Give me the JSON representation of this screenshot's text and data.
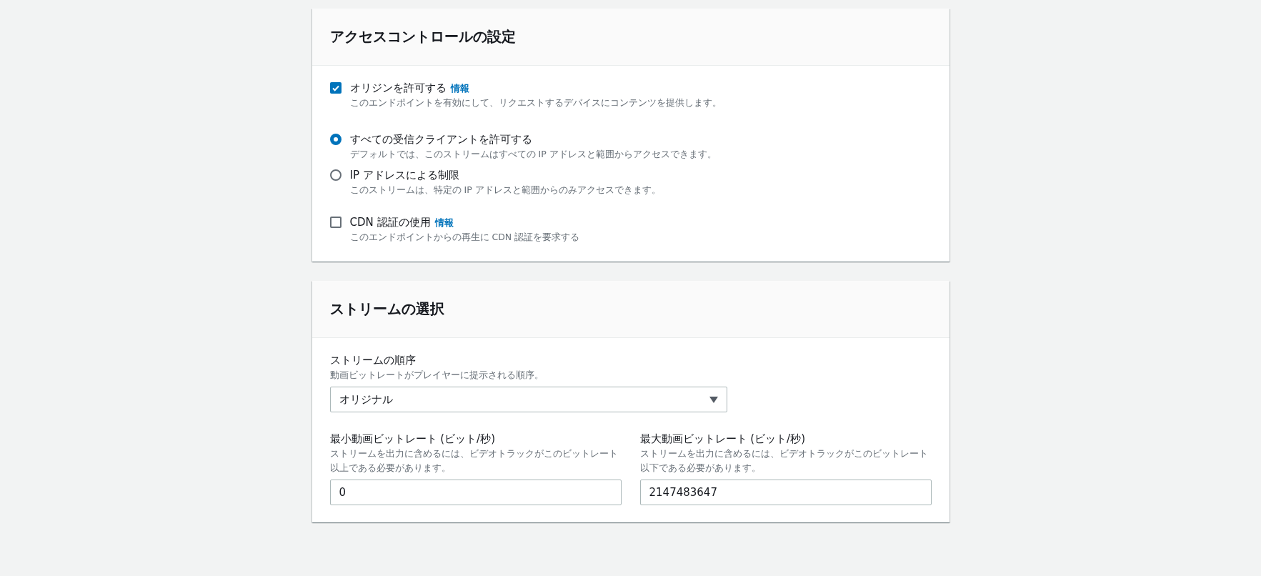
{
  "access_control": {
    "title": "アクセスコントロールの設定",
    "options": [
      {
        "kind": "checkbox",
        "label": "オリジンを許可する",
        "info": "情報",
        "description": "このエンドポイントを有効にして、リクエストするデバイスにコンテンツを提供します。",
        "checked": true
      },
      {
        "kind": "radio",
        "label": "すべての受信クライアントを許可する",
        "description": "デフォルトでは、このストリームはすべての IP アドレスと範囲からアクセスできます。",
        "selected": true
      },
      {
        "kind": "radio",
        "label": "IP アドレスによる制限",
        "description": "このストリームは、特定の IP アドレスと範囲からのみアクセスできます。",
        "selected": false
      },
      {
        "kind": "checkbox",
        "label": "CDN 認証の使用",
        "info": "情報",
        "description": "このエンドポイントからの再生に CDN 認証を要求する",
        "checked": false
      }
    ]
  },
  "stream_selection": {
    "title": "ストリームの選択",
    "order": {
      "label": "ストリームの順序",
      "description": "動画ビットレートがプレイヤーに提示される順序。",
      "value": "オリジナル"
    },
    "bitrates": [
      {
        "label": "最小動画ビットレート (ビット/秒)",
        "description": "ストリームを出力に含めるには、ビデオトラックがこのビットレート以上である必要があります。",
        "value": "0"
      },
      {
        "label": "最大動画ビットレート (ビット/秒)",
        "description": "ストリームを出力に含めるには、ビデオトラックがこのビットレート以下である必要があります。",
        "value": "2147483647"
      }
    ]
  }
}
